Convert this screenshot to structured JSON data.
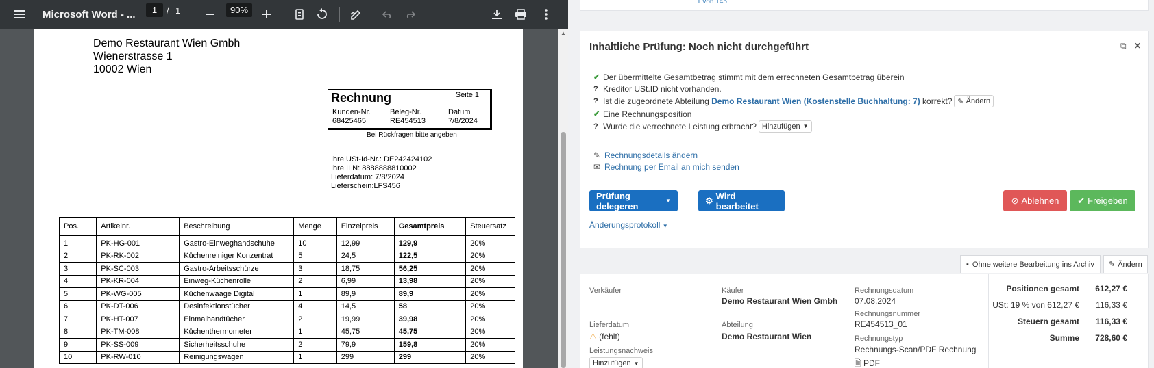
{
  "pdf_viewer": {
    "title": "Microsoft Word - ...",
    "page_current": "1",
    "page_sep": "/",
    "page_total": "1",
    "zoom": "90%",
    "icons": [
      "menu-icon",
      "zoom-out-icon",
      "zoom-in-icon",
      "fit-page-icon",
      "rotate-icon",
      "annotate-icon",
      "undo-icon",
      "redo-icon",
      "download-icon",
      "print-icon",
      "more-icon"
    ]
  },
  "invoice": {
    "sender": [
      "Demo Restaurant Wien Gmbh",
      "Wienerstrasse 1",
      "10002 Wien"
    ],
    "box_title": "Rechnung",
    "seite": "Seite 1",
    "kunden_label": "Kunden-Nr.",
    "kunden_value": "68425465",
    "beleg_label": "Beleg-Nr.",
    "beleg_value": "RE454513",
    "datum_label": "Datum",
    "datum_value": "7/8/2024",
    "note": "Bei Rückfragen bitte angeben",
    "info": [
      "Ihre USt-Id-Nr.: DE242424102",
      "Ihre ILN: 8888888810002",
      "Lieferdatum: 7/8/2024",
      "Lieferschein:LFS456"
    ],
    "columns": [
      "Pos.",
      "Artikelnr.",
      "Beschreibung",
      "Menge",
      "Einzelpreis",
      "Gesamtpreis",
      "Steuersatz"
    ],
    "rows": [
      [
        "1",
        "PK-HG-001",
        "Gastro-Einweghandschuhe",
        "10",
        "12,99",
        "129,9",
        "20%"
      ],
      [
        "2",
        "PK-RK-002",
        "Küchenreiniger Konzentrat",
        "5",
        "24,5",
        "122,5",
        "20%"
      ],
      [
        "3",
        "PK-SC-003",
        "Gastro-Arbeitsschürze",
        "3",
        "18,75",
        "56,25",
        "20%"
      ],
      [
        "4",
        "PK-KR-004",
        "Einweg-Küchenrolle",
        "2",
        "6,99",
        "13,98",
        "20%"
      ],
      [
        "5",
        "PK-WG-005",
        "Küchenwaage Digital",
        "1",
        "89,9",
        "89,9",
        "20%"
      ],
      [
        "6",
        "PK-DT-006",
        "Desinfektionstücher",
        "4",
        "14,5",
        "58",
        "20%"
      ],
      [
        "7",
        "PK-HT-007",
        "Einmalhandtücher",
        "2",
        "19,99",
        "39,98",
        "20%"
      ],
      [
        "8",
        "PK-TM-008",
        "Küchenthermometer",
        "1",
        "45,75",
        "45,75",
        "20%"
      ],
      [
        "9",
        "PK-SS-009",
        "Sicherheitsschuhe",
        "2",
        "79,9",
        "159,8",
        "20%"
      ],
      [
        "10",
        "PK-RW-010",
        "Reinigungswagen",
        "1",
        "299",
        "299",
        "20%"
      ]
    ]
  },
  "top_card": {
    "pager": "1 von 145"
  },
  "check": {
    "title": "Inhaltliche Prüfung: Noch nicht durchgeführt",
    "items": [
      {
        "status": "ok",
        "text": "Der übermittelte Gesamtbetrag stimmt mit dem errechneten Gesamtbetrag überein"
      },
      {
        "status": "q",
        "text": "Kreditor USt.ID nicht vorhanden."
      },
      {
        "status": "q",
        "text_before": "Ist die zugeordnete Abteilung ",
        "link": "Demo Restaurant Wien (Kostenstelle Buchhaltung: 7)",
        "text_after": " korrekt?",
        "button": "Ändern"
      },
      {
        "status": "ok",
        "text": "Eine Rechnungsposition"
      },
      {
        "status": "q",
        "text": "Wurde die verrechnete Leistung erbracht?",
        "button": "Hinzufügen"
      }
    ],
    "actions": [
      "Rechnungsdetails ändern",
      "Rechnung per Email an mich senden"
    ],
    "btn_delegate": "Prüfung delegeren",
    "btn_processing": "Wird bearbeitet",
    "btn_reject": "Ablehnen",
    "btn_approve": "Freigeben",
    "protokoll": "Änderungsprotokoll"
  },
  "archive_btn": "Ohne weitere Bearbeitung ins Archiv",
  "edit_btn": "Ändern",
  "details": {
    "verkaeufer_label": "Verkäufer",
    "lieferdatum_label": "Lieferdatum",
    "lieferdatum_value": "(fehlt)",
    "leistung_label": "Leistungsnachweis",
    "leistung_btn": "Hinzufügen",
    "kaeufer_label": "Käufer",
    "kaeufer_value": "Demo Restaurant Wien Gmbh",
    "abteilung_label": "Abteilung",
    "abteilung_value": "Demo Restaurant Wien",
    "rdatum_label": "Rechnungsdatum",
    "rdatum_value": "07.08.2024",
    "rnummer_label": "Rechnungsnummer",
    "rnummer_value": "RE454513_01",
    "rtyp_label": "Rechnungstyp",
    "rtyp_value": "Rechnungs-Scan/PDF Rechnung",
    "pdf_link": "PDF"
  },
  "summary": [
    {
      "label": "Positionen gesamt",
      "value": "612,27 €",
      "bold": true
    },
    {
      "label": "USt: 19 % von 612,27 €",
      "value": "116,33 €",
      "bold": false
    },
    {
      "label": "Steuern gesamt",
      "value": "116,33 €",
      "bold": true
    },
    {
      "label": "Summe",
      "value": "728,60 €",
      "bold": true
    }
  ]
}
